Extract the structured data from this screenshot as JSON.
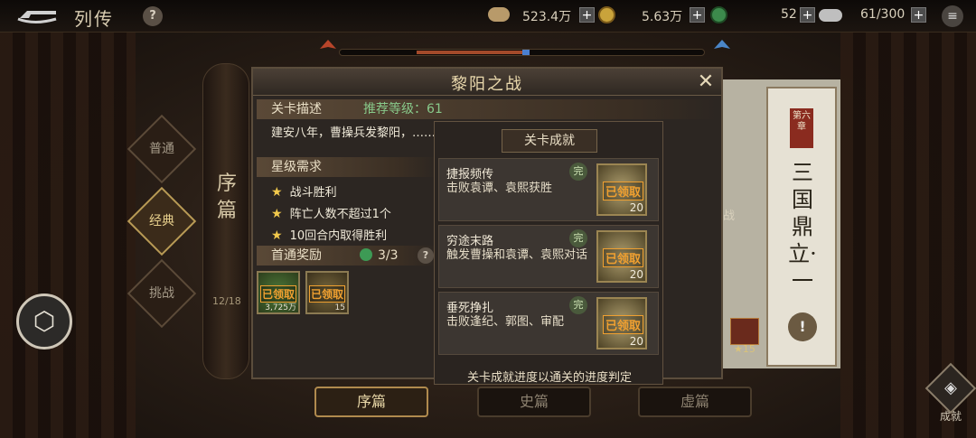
{
  "header": {
    "title": "列传",
    "help": "?",
    "resource1": "523.4万",
    "resource2": "5.63万",
    "resource3": "52",
    "resource4": "61/300",
    "plus": "+",
    "menu": "≡"
  },
  "left_nav": {
    "scroll_title": "序篇",
    "count": "12/18",
    "tabs": [
      "普通",
      "经典",
      "挑战"
    ]
  },
  "dialog": {
    "title": "黎阳之战",
    "close": "✕",
    "desc_label": "关卡描述",
    "recommend": "推荐等级：61",
    "description": "建安八年，曹操兵发黎阳，……袁氏兄弟聚拢人马与曹操决战",
    "star_label": "星级需求",
    "conditions": [
      "战斗胜利",
      "阵亡人数不超过1个",
      "10回合内取得胜利"
    ],
    "first_label": "首通奖励",
    "first_count": "3/3",
    "first_help": "?",
    "rewards": [
      {
        "stamp": "已领取",
        "qty": "3,725万"
      },
      {
        "stamp": "已领取",
        "qty": "15"
      }
    ]
  },
  "achievements": {
    "title": "关卡成就",
    "items": [
      {
        "name": "捷报频传",
        "desc": "击败袁谭、袁熙获胜",
        "done": "完",
        "stamp": "已领取",
        "qty": "20"
      },
      {
        "name": "穷途末路",
        "desc": "触发曹操和袁谭、袁熙对话",
        "done": "完",
        "stamp": "已领取",
        "qty": "20"
      },
      {
        "name": "垂死挣扎",
        "desc": "击败逢纪、郭图、审配",
        "done": "完",
        "stamp": "已领取",
        "qty": "20"
      }
    ],
    "footer": "关卡成就进度以通关的进度判定"
  },
  "right_panel": {
    "badge": "第六章",
    "title": "三国鼎立·一",
    "side_label": "战",
    "chest_stars": "★15",
    "warn": "!"
  },
  "bottom_tabs": [
    "序篇",
    "史篇",
    "虚篇"
  ],
  "achievement_button": "成就",
  "colors": {
    "accent_gold": "#e9d8a8",
    "recommend_green": "#88c98a",
    "star_yellow": "#f2c94c",
    "stamp_orange": "#f0a030"
  },
  "icons": [
    "back-arrow-icon",
    "coin-icon",
    "jade-icon",
    "silver-icon",
    "menu-icon",
    "close-icon",
    "star-icon",
    "swirl-icon",
    "3d-view-icon",
    "achievement-icon"
  ]
}
